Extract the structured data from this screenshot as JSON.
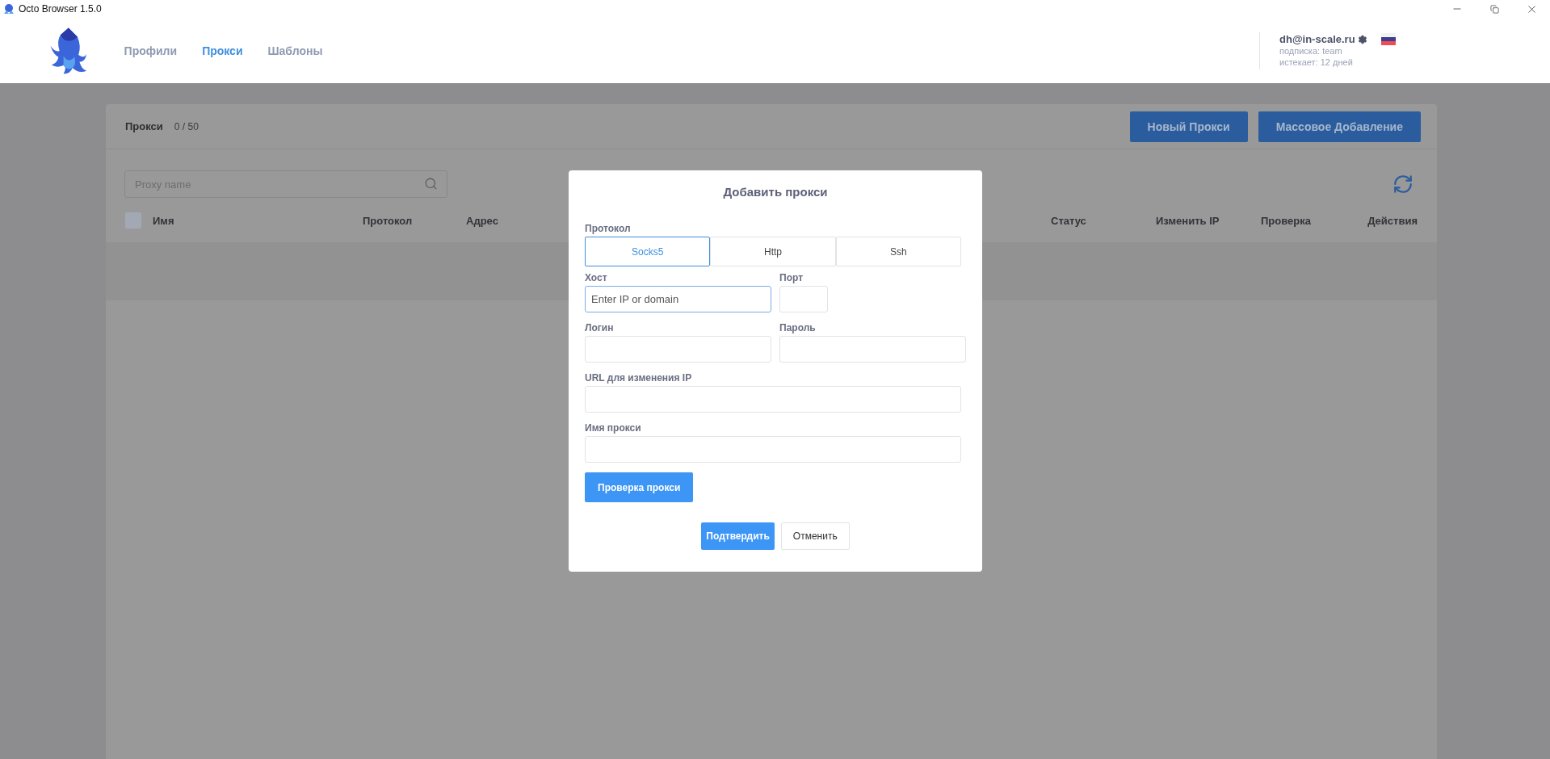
{
  "window": {
    "title": "Octo Browser 1.5.0"
  },
  "nav": {
    "items": [
      {
        "label": "Профили",
        "selected": false
      },
      {
        "label": "Прокси",
        "selected": true
      },
      {
        "label": "Шаблоны",
        "selected": false
      }
    ]
  },
  "account": {
    "email": "dh@in-scale.ru",
    "subscription": "подписка: team",
    "expires": "истекает: 12 дней"
  },
  "proxies": {
    "title": "Прокси",
    "count": "0 / 50",
    "buttons": [
      "Новый Прокси",
      "Массовое Добавление"
    ],
    "search": {
      "placeholder": "Proxy name"
    },
    "select_all": {
      "checked": false
    },
    "columns": [
      {
        "label": "Имя",
        "kind": "name"
      },
      {
        "label": "Протокол",
        "kind": "protocol"
      },
      {
        "label": "Адрес",
        "kind": "address"
      },
      {
        "label": "Статус",
        "kind": "status"
      },
      {
        "label": "Изменить IP",
        "kind": "change"
      },
      {
        "label": "Проверка",
        "kind": "check"
      },
      {
        "label": "Действия",
        "kind": "actions"
      }
    ]
  },
  "dialog": {
    "title": "Добавить прокси",
    "protocol_label": "Протокол",
    "protocols": [
      {
        "label": "Socks5",
        "selected": true
      },
      {
        "label": "Http",
        "selected": false
      },
      {
        "label": "Ssh",
        "selected": false
      }
    ],
    "rows": [
      [
        {
          "label": "Хост",
          "placeholder": "Enter IP or domain",
          "kind": "half",
          "focused": true
        },
        {
          "label": "Порт",
          "kind": "short",
          "focused": false
        }
      ],
      [
        {
          "label": "Логин",
          "kind": "half",
          "focused": false
        },
        {
          "label": "Пароль",
          "kind": "half",
          "focused": false
        }
      ],
      [
        {
          "label": "URL для изменения IP",
          "kind": "full",
          "focused": false
        }
      ],
      [
        {
          "label": "Имя прокси",
          "kind": "full",
          "focused": false
        }
      ]
    ],
    "check_button": "Проверка прокси",
    "confirm": "Подтвердить",
    "cancel": "Отменить"
  }
}
